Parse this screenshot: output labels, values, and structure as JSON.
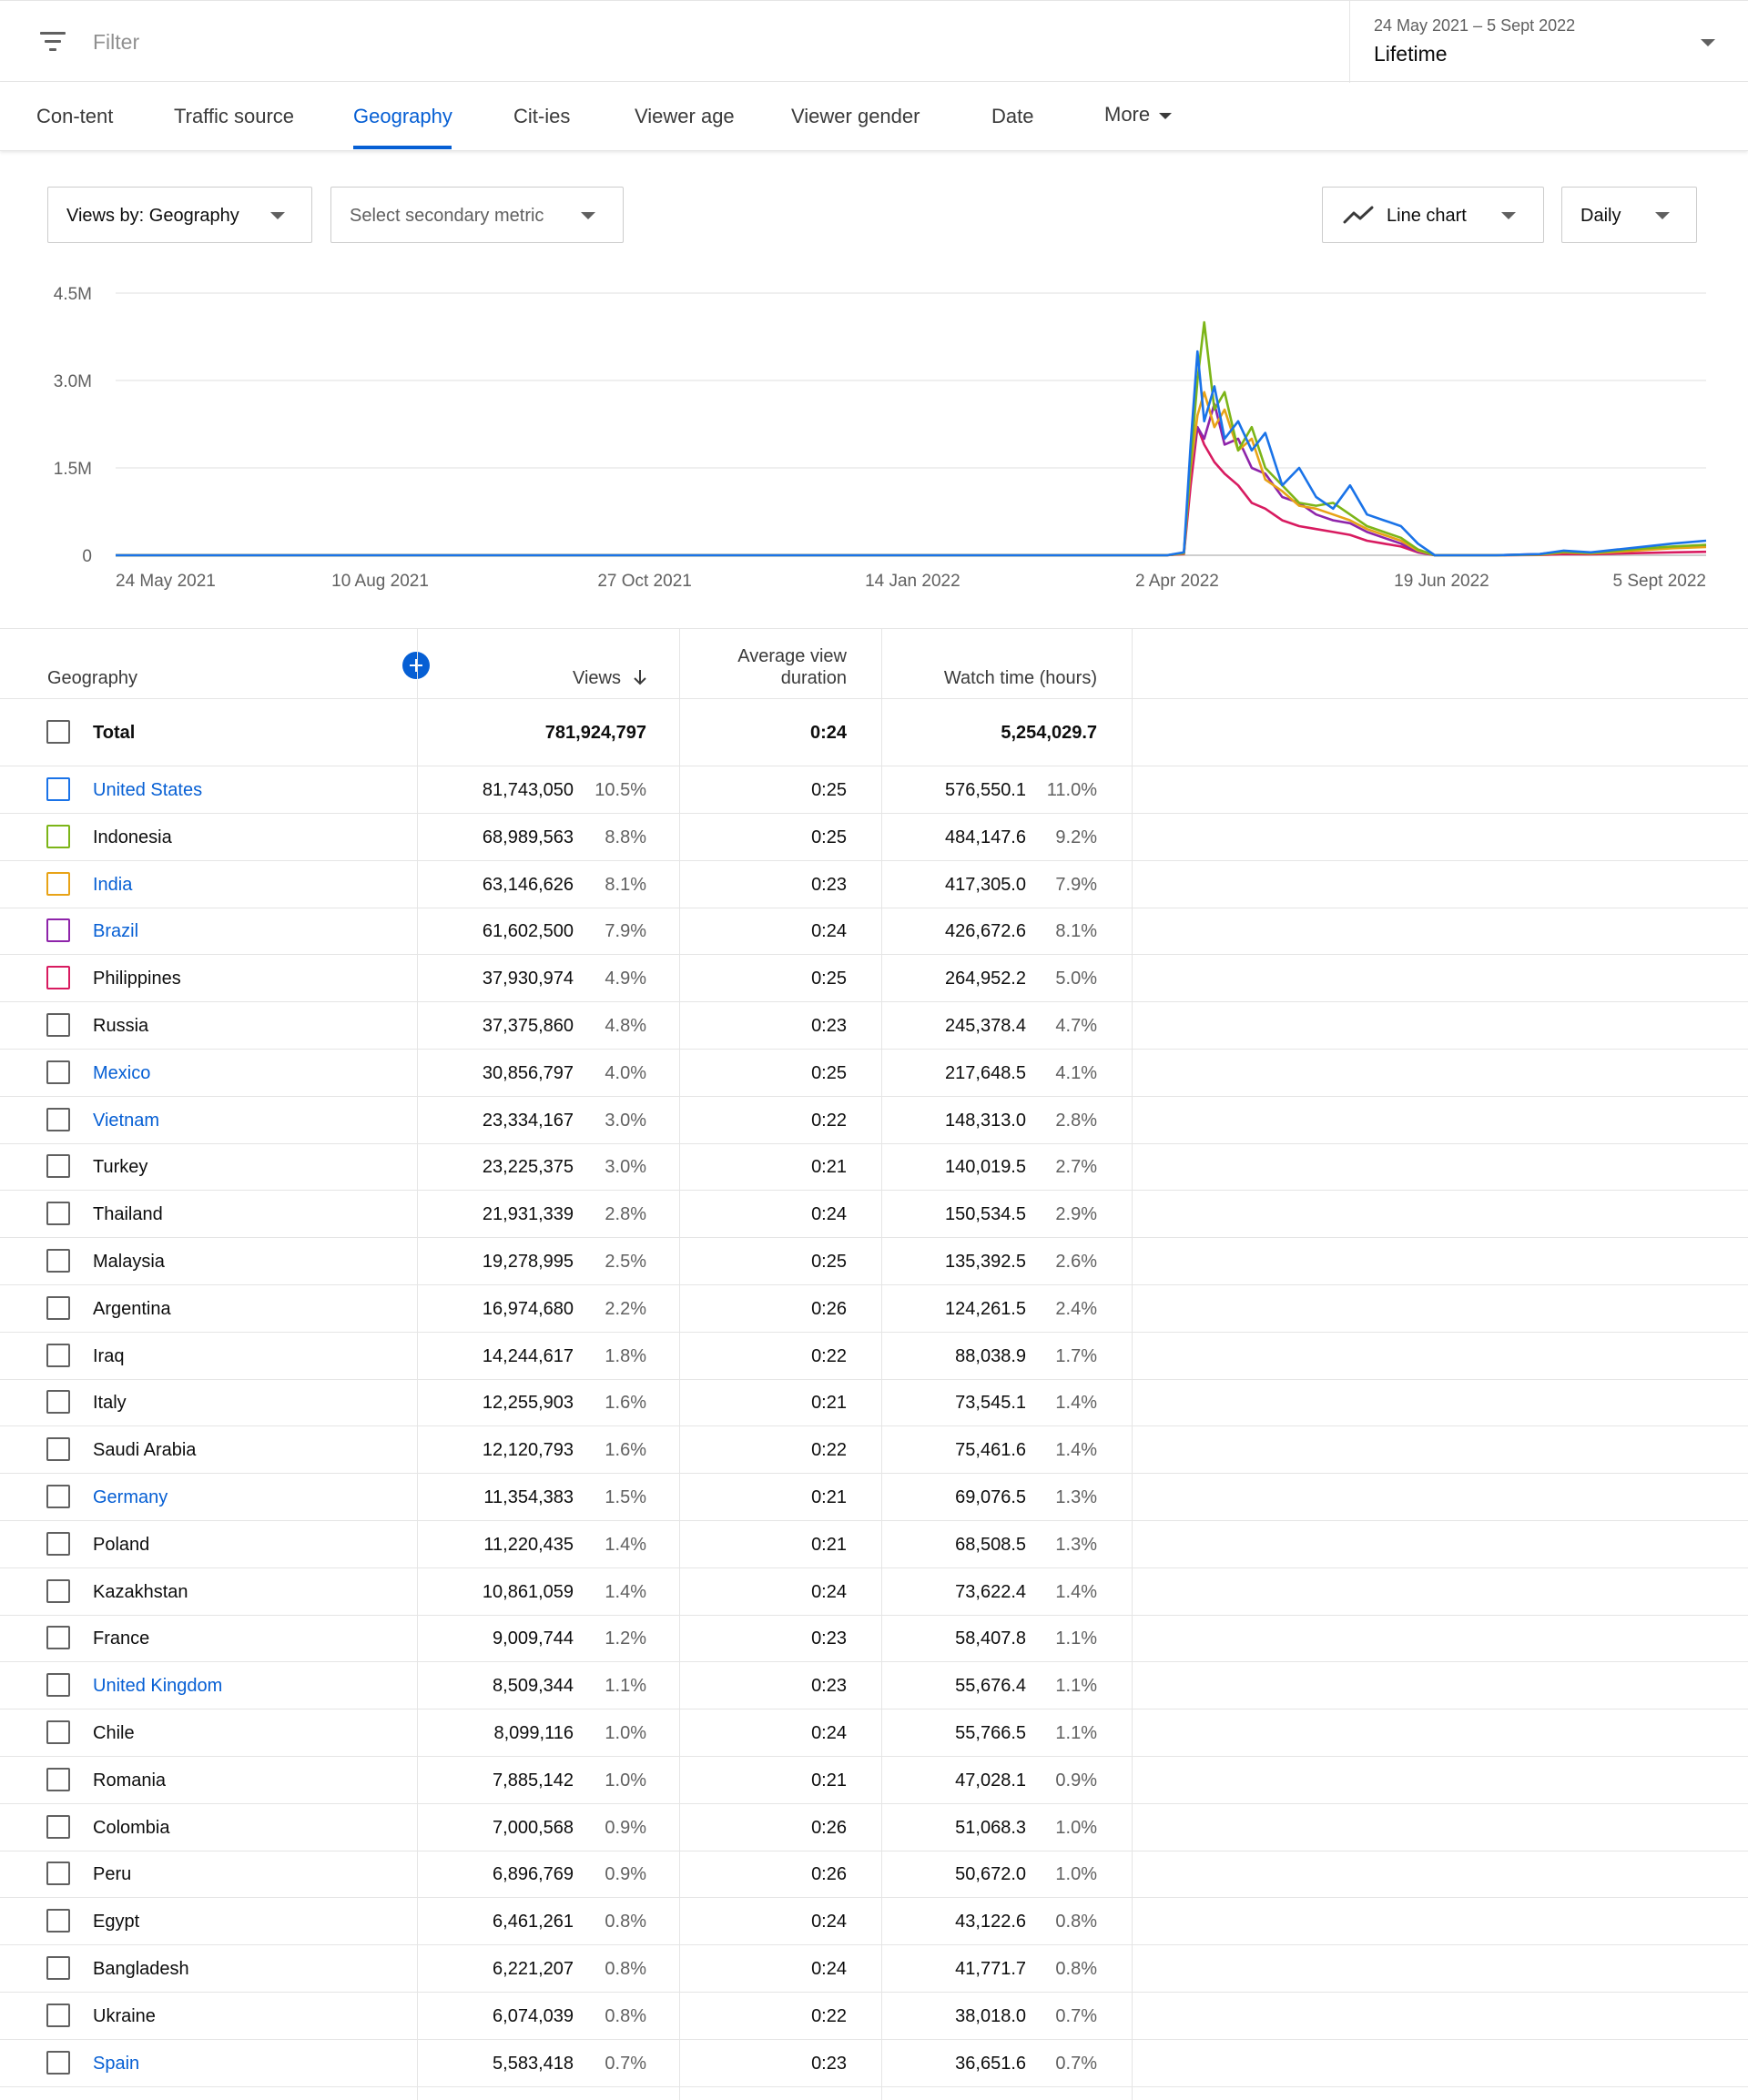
{
  "filter": {
    "placeholder": "Filter"
  },
  "date_range": {
    "range": "24 May 2021 – 5 Sept 2022",
    "label": "Lifetime"
  },
  "tabs": [
    {
      "label": "Con-tent",
      "active": false
    },
    {
      "label": "Traffic source",
      "active": false
    },
    {
      "label": "Geography",
      "active": true
    },
    {
      "label": "Cit-ies",
      "active": false
    },
    {
      "label": "Viewer age",
      "active": false
    },
    {
      "label": "Viewer gender",
      "active": false
    },
    {
      "label": "Date",
      "active": false
    },
    {
      "label": "More",
      "active": false
    }
  ],
  "controls": {
    "primary_metric": "Views by: Geography",
    "secondary_metric": "Select secondary metric",
    "chart_type": "Line chart",
    "interval": "Daily"
  },
  "colors": {
    "accent": "#065fd4",
    "united_states": "#1a73e8",
    "indonesia": "#7cb518",
    "india": "#e8a317",
    "brazil": "#8e24aa",
    "philippines": "#d81b60"
  },
  "chart_data": {
    "type": "line",
    "title": "",
    "xlabel": "",
    "ylabel": "",
    "y_ticks": [
      "0",
      "1.5M",
      "3.0M",
      "4.5M"
    ],
    "ylim": [
      0,
      4500000
    ],
    "x_ticks": [
      "24 May 2021",
      "10 Aug 2021",
      "27 Oct 2021",
      "14 Jan 2022",
      "2 Apr 2022",
      "19 Jun 2022",
      "5 Sept 2022"
    ],
    "x_range": [
      "2021-05-24",
      "2022-09-05"
    ],
    "grid": true,
    "dates": [
      "2021-05-24",
      "2022-03-30",
      "2022-04-04",
      "2022-04-06",
      "2022-04-08",
      "2022-04-10",
      "2022-04-13",
      "2022-04-16",
      "2022-04-20",
      "2022-04-24",
      "2022-04-28",
      "2022-05-03",
      "2022-05-08",
      "2022-05-13",
      "2022-05-18",
      "2022-05-23",
      "2022-05-28",
      "2022-06-02",
      "2022-06-07",
      "2022-06-12",
      "2022-06-17",
      "2022-06-22",
      "2022-07-05",
      "2022-07-18",
      "2022-07-25",
      "2022-08-02",
      "2022-08-10",
      "2022-08-18",
      "2022-08-26",
      "2022-09-05"
    ],
    "series": [
      {
        "key": "united_states",
        "values": [
          0,
          0,
          50000,
          1900000,
          3500000,
          2300000,
          2900000,
          2000000,
          2300000,
          1800000,
          2100000,
          1200000,
          1500000,
          1000000,
          800000,
          1200000,
          700000,
          600000,
          500000,
          200000,
          0,
          0,
          0,
          20000,
          80000,
          50000,
          100000,
          150000,
          200000,
          250000
        ]
      },
      {
        "key": "indonesia",
        "values": [
          0,
          0,
          40000,
          1600000,
          3000000,
          4000000,
          2500000,
          2800000,
          1800000,
          2200000,
          1500000,
          1200000,
          900000,
          850000,
          900000,
          700000,
          500000,
          400000,
          300000,
          100000,
          0,
          0,
          0,
          15000,
          60000,
          40000,
          80000,
          120000,
          150000,
          180000
        ]
      },
      {
        "key": "india",
        "values": [
          0,
          0,
          30000,
          1500000,
          2400000,
          2800000,
          2200000,
          2500000,
          1800000,
          2000000,
          1300000,
          1100000,
          850000,
          800000,
          700000,
          600000,
          450000,
          350000,
          250000,
          80000,
          0,
          0,
          0,
          10000,
          50000,
          30000,
          60000,
          90000,
          120000,
          140000
        ]
      },
      {
        "key": "brazil",
        "values": [
          0,
          0,
          30000,
          1500000,
          2200000,
          2000000,
          2600000,
          1900000,
          2000000,
          1500000,
          1400000,
          1000000,
          900000,
          700000,
          600000,
          550000,
          400000,
          300000,
          200000,
          60000,
          0,
          0,
          0,
          20000,
          70000,
          40000,
          70000,
          110000,
          140000,
          170000
        ]
      },
      {
        "key": "philippines",
        "values": [
          0,
          0,
          20000,
          1200000,
          2200000,
          1900000,
          1600000,
          1400000,
          1200000,
          900000,
          800000,
          600000,
          500000,
          450000,
          400000,
          350000,
          250000,
          200000,
          150000,
          50000,
          0,
          0,
          0,
          5000,
          20000,
          15000,
          30000,
          40000,
          50000,
          60000
        ]
      }
    ]
  },
  "table": {
    "headers": {
      "geography": "Geography",
      "views": "Views",
      "avg_line1": "Average view",
      "avg_line2": "duration",
      "watch_time": "Watch time (hours)"
    },
    "total": {
      "label": "Total",
      "views": "781,924,797",
      "avg": "0:24",
      "watch": "5,254,029.7"
    },
    "rows": [
      {
        "name": "United States",
        "views": "81,743,050",
        "vpct": "10.5%",
        "avg": "0:25",
        "watch": "576,550.1",
        "wpct": "11.0%",
        "link": true,
        "box": "#1a73e8"
      },
      {
        "name": "Indonesia",
        "views": "68,989,563",
        "vpct": "8.8%",
        "avg": "0:25",
        "watch": "484,147.6",
        "wpct": "9.2%",
        "link": false,
        "box": "#7cb518"
      },
      {
        "name": "India",
        "views": "63,146,626",
        "vpct": "8.1%",
        "avg": "0:23",
        "watch": "417,305.0",
        "wpct": "7.9%",
        "link": true,
        "box": "#e8a317"
      },
      {
        "name": "Brazil",
        "views": "61,602,500",
        "vpct": "7.9%",
        "avg": "0:24",
        "watch": "426,672.6",
        "wpct": "8.1%",
        "link": true,
        "box": "#8e24aa"
      },
      {
        "name": "Philippines",
        "views": "37,930,974",
        "vpct": "4.9%",
        "avg": "0:25",
        "watch": "264,952.2",
        "wpct": "5.0%",
        "link": false,
        "box": "#d81b60"
      },
      {
        "name": "Russia",
        "views": "37,375,860",
        "vpct": "4.8%",
        "avg": "0:23",
        "watch": "245,378.4",
        "wpct": "4.7%",
        "link": false,
        "box": ""
      },
      {
        "name": "Mexico",
        "views": "30,856,797",
        "vpct": "4.0%",
        "avg": "0:25",
        "watch": "217,648.5",
        "wpct": "4.1%",
        "link": true,
        "box": ""
      },
      {
        "name": "Vietnam",
        "views": "23,334,167",
        "vpct": "3.0%",
        "avg": "0:22",
        "watch": "148,313.0",
        "wpct": "2.8%",
        "link": true,
        "box": ""
      },
      {
        "name": "Turkey",
        "views": "23,225,375",
        "vpct": "3.0%",
        "avg": "0:21",
        "watch": "140,019.5",
        "wpct": "2.7%",
        "link": false,
        "box": ""
      },
      {
        "name": "Thailand",
        "views": "21,931,339",
        "vpct": "2.8%",
        "avg": "0:24",
        "watch": "150,534.5",
        "wpct": "2.9%",
        "link": false,
        "box": ""
      },
      {
        "name": "Malaysia",
        "views": "19,278,995",
        "vpct": "2.5%",
        "avg": "0:25",
        "watch": "135,392.5",
        "wpct": "2.6%",
        "link": false,
        "box": ""
      },
      {
        "name": "Argentina",
        "views": "16,974,680",
        "vpct": "2.2%",
        "avg": "0:26",
        "watch": "124,261.5",
        "wpct": "2.4%",
        "link": false,
        "box": ""
      },
      {
        "name": "Iraq",
        "views": "14,244,617",
        "vpct": "1.8%",
        "avg": "0:22",
        "watch": "88,038.9",
        "wpct": "1.7%",
        "link": false,
        "box": ""
      },
      {
        "name": "Italy",
        "views": "12,255,903",
        "vpct": "1.6%",
        "avg": "0:21",
        "watch": "73,545.1",
        "wpct": "1.4%",
        "link": false,
        "box": ""
      },
      {
        "name": "Saudi Arabia",
        "views": "12,120,793",
        "vpct": "1.6%",
        "avg": "0:22",
        "watch": "75,461.6",
        "wpct": "1.4%",
        "link": false,
        "box": ""
      },
      {
        "name": "Germany",
        "views": "11,354,383",
        "vpct": "1.5%",
        "avg": "0:21",
        "watch": "69,076.5",
        "wpct": "1.3%",
        "link": true,
        "box": ""
      },
      {
        "name": "Poland",
        "views": "11,220,435",
        "vpct": "1.4%",
        "avg": "0:21",
        "watch": "68,508.5",
        "wpct": "1.3%",
        "link": false,
        "box": ""
      },
      {
        "name": "Kazakhstan",
        "views": "10,861,059",
        "vpct": "1.4%",
        "avg": "0:24",
        "watch": "73,622.4",
        "wpct": "1.4%",
        "link": false,
        "box": ""
      },
      {
        "name": "France",
        "views": "9,009,744",
        "vpct": "1.2%",
        "avg": "0:23",
        "watch": "58,407.8",
        "wpct": "1.1%",
        "link": false,
        "box": ""
      },
      {
        "name": "United Kingdom",
        "views": "8,509,344",
        "vpct": "1.1%",
        "avg": "0:23",
        "watch": "55,676.4",
        "wpct": "1.1%",
        "link": true,
        "box": ""
      },
      {
        "name": "Chile",
        "views": "8,099,116",
        "vpct": "1.0%",
        "avg": "0:24",
        "watch": "55,766.5",
        "wpct": "1.1%",
        "link": false,
        "box": ""
      },
      {
        "name": "Romania",
        "views": "7,885,142",
        "vpct": "1.0%",
        "avg": "0:21",
        "watch": "47,028.1",
        "wpct": "0.9%",
        "link": false,
        "box": ""
      },
      {
        "name": "Colombia",
        "views": "7,000,568",
        "vpct": "0.9%",
        "avg": "0:26",
        "watch": "51,068.3",
        "wpct": "1.0%",
        "link": false,
        "box": ""
      },
      {
        "name": "Peru",
        "views": "6,896,769",
        "vpct": "0.9%",
        "avg": "0:26",
        "watch": "50,672.0",
        "wpct": "1.0%",
        "link": false,
        "box": ""
      },
      {
        "name": "Egypt",
        "views": "6,461,261",
        "vpct": "0.8%",
        "avg": "0:24",
        "watch": "43,122.6",
        "wpct": "0.8%",
        "link": false,
        "box": ""
      },
      {
        "name": "Bangladesh",
        "views": "6,221,207",
        "vpct": "0.8%",
        "avg": "0:24",
        "watch": "41,771.7",
        "wpct": "0.8%",
        "link": false,
        "box": ""
      },
      {
        "name": "Ukraine",
        "views": "6,074,039",
        "vpct": "0.8%",
        "avg": "0:22",
        "watch": "38,018.0",
        "wpct": "0.7%",
        "link": false,
        "box": ""
      },
      {
        "name": "Spain",
        "views": "5,583,418",
        "vpct": "0.7%",
        "avg": "0:23",
        "watch": "36,651.6",
        "wpct": "0.7%",
        "link": true,
        "box": ""
      }
    ]
  }
}
